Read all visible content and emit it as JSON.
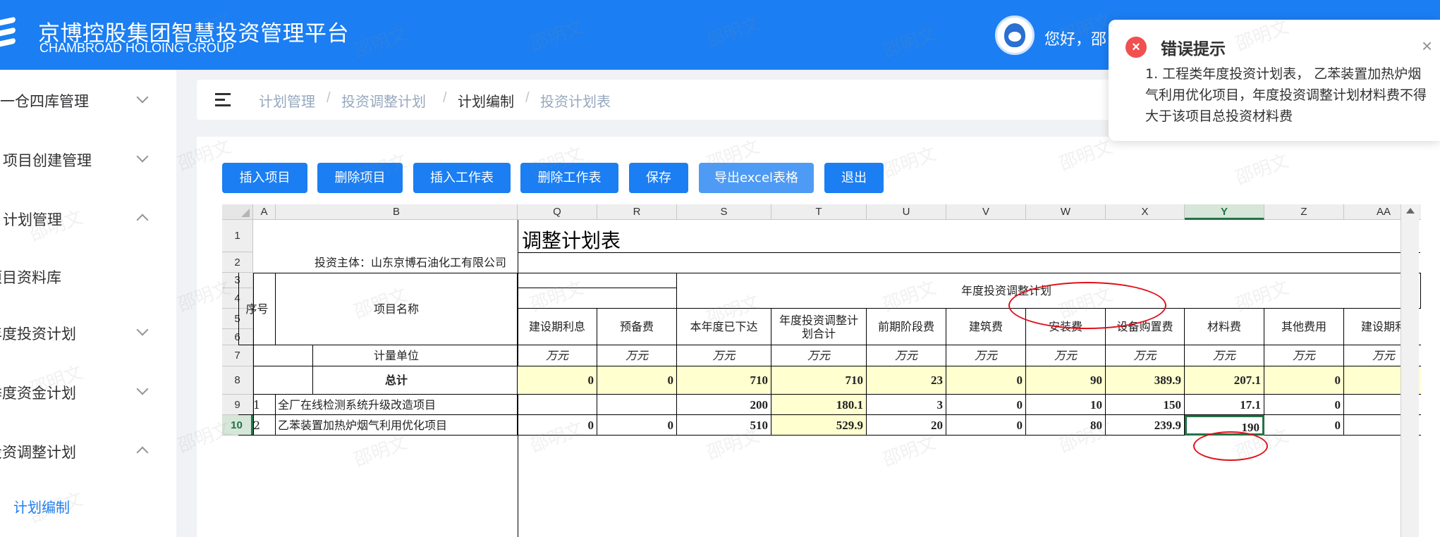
{
  "header": {
    "title": "京博控股集团智慧投资管理平台",
    "subtitle": "CHAMBROAD HOLOING GROUP",
    "greeting": "您好，邵"
  },
  "sidebar": {
    "items": [
      {
        "label": "一仓四库管理",
        "chevron": "down"
      },
      {
        "label": "项目创建管理",
        "chevron": "down"
      },
      {
        "label": "计划管理",
        "chevron": "up"
      },
      {
        "label": "项目资料库",
        "chevron": ""
      },
      {
        "label": "年度投资计划",
        "chevron": "down"
      },
      {
        "label": "季度资金计划",
        "chevron": "down"
      },
      {
        "label": "投资调整计划",
        "chevron": "up"
      }
    ],
    "active_sub": "计划编制"
  },
  "breadcrumb": [
    "计划管理",
    "投资调整计划",
    "计划编制",
    "投资计划表"
  ],
  "toolbar": {
    "insert_project": "插入项目",
    "delete_project": "删除项目",
    "insert_sheet": "插入工作表",
    "delete_sheet": "删除工作表",
    "save": "保存",
    "export": "导出excel表格",
    "exit": "退出"
  },
  "sheet": {
    "col_letters": [
      "A",
      "B",
      "Q",
      "R",
      "S",
      "T",
      "U",
      "V",
      "W",
      "X",
      "Y",
      "Z",
      "AA"
    ],
    "row_numbers": [
      "1",
      "2",
      "3",
      "4",
      "5",
      "6",
      "7",
      "8",
      "9",
      "10"
    ],
    "selected_col": "Y",
    "selected_row": "10",
    "title": "调整计划表",
    "subject": "投资主体：山东京博石油化工有限公司",
    "group_header": "年度投资调整计划",
    "seq_header": "序号",
    "name_header": "项目名称",
    "unit_label": "计量单位",
    "columns": [
      "建设期利息",
      "预备费",
      "本年度已下达",
      "年度投资调整计划合计",
      "前期阶段费",
      "建筑费",
      "安装费",
      "设备购置费",
      "材料费",
      "其他费用",
      "建设期利"
    ],
    "units": [
      "万元",
      "万元",
      "万元",
      "万元",
      "万元",
      "万元",
      "万元",
      "万元",
      "万元",
      "万元",
      "万元"
    ],
    "total_row": {
      "label": "总计",
      "values": [
        "0",
        "0",
        "710",
        "710",
        "23",
        "0",
        "90",
        "389.9",
        "207.1",
        "0",
        ""
      ]
    },
    "rows": [
      {
        "seq": "1",
        "name": "全厂在线检测系统升级改造项目",
        "values": [
          "",
          "",
          "200",
          "180.1",
          "3",
          "0",
          "10",
          "150",
          "17.1",
          "0",
          ""
        ]
      },
      {
        "seq": "2",
        "name": "乙苯装置加热炉烟气利用优化项目",
        "values": [
          "0",
          "0",
          "510",
          "529.9",
          "20",
          "0",
          "80",
          "239.9",
          "190",
          "0",
          ""
        ]
      }
    ]
  },
  "toast": {
    "title": "错误提示",
    "message": "1. 工程类年度投资计划表， 乙苯装置加热炉烟气利用优化项目，年度投资调整计划材料费不得大于该项目总投资材料费",
    "icon": "error-icon"
  },
  "watermark": "邵明文"
}
